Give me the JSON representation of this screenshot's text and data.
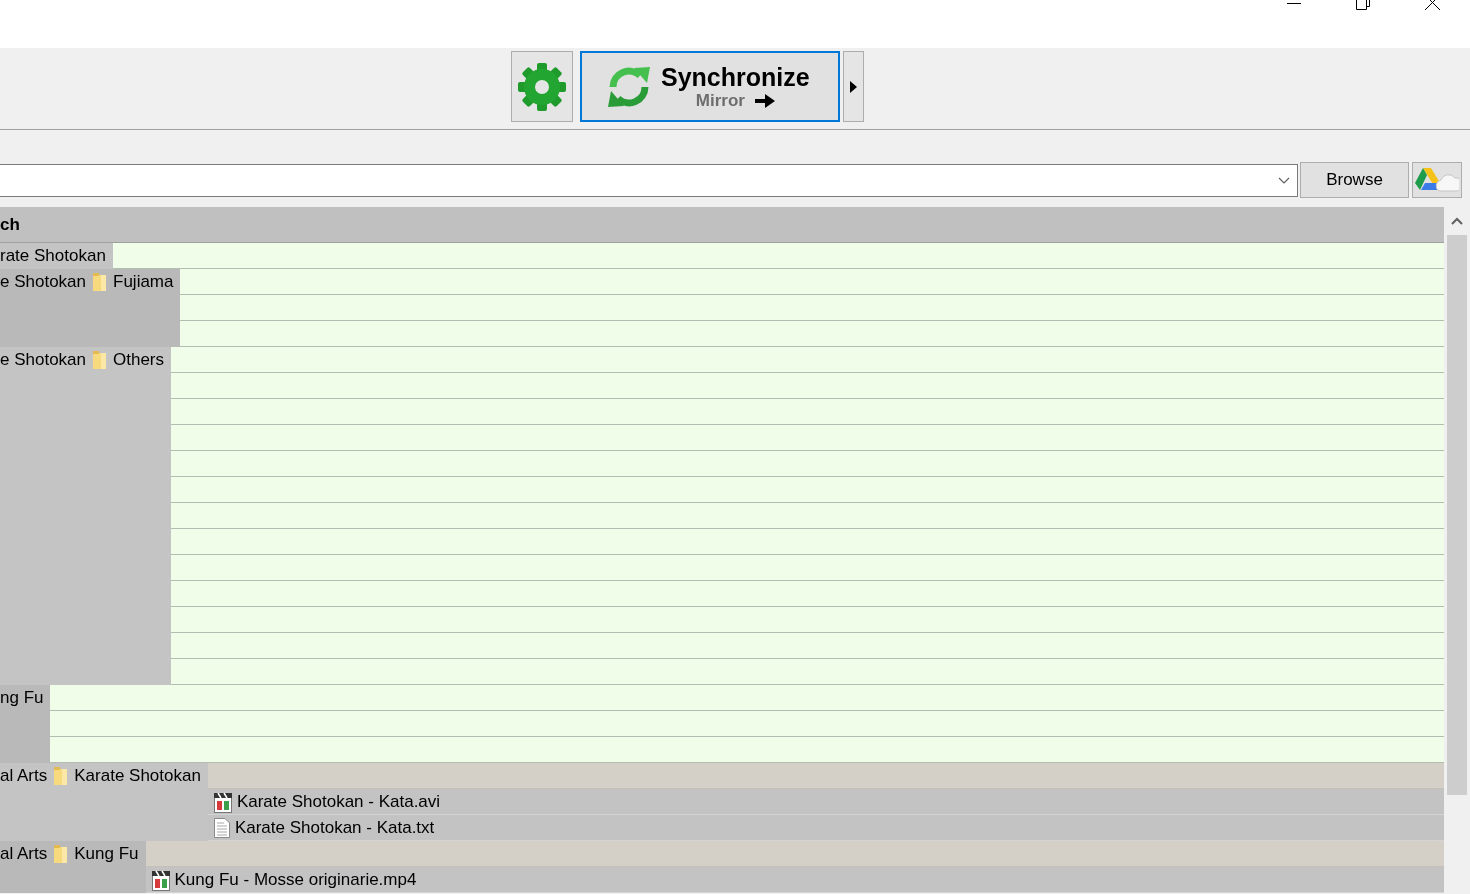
{
  "toolbar": {
    "sync_button": {
      "title": "Synchronize",
      "subtitle": "Mirror",
      "focused": true
    }
  },
  "folder_bar": {
    "browse_button": "Browse"
  },
  "grid": {
    "header": "ch",
    "groups": [
      {
        "path": [
          "rate Shotokan"
        ],
        "rows": [
          {
            "kind": "blank"
          }
        ]
      },
      {
        "path": [
          "e Shotokan",
          "Fujiama"
        ],
        "rows": [
          {
            "kind": "blank"
          },
          {
            "kind": "blank"
          },
          {
            "kind": "blank"
          }
        ]
      },
      {
        "path": [
          "e Shotokan",
          "Others"
        ],
        "rows": [
          {
            "kind": "blank"
          },
          {
            "kind": "blank"
          },
          {
            "kind": "blank"
          },
          {
            "kind": "blank"
          },
          {
            "kind": "blank"
          },
          {
            "kind": "blank"
          },
          {
            "kind": "blank"
          },
          {
            "kind": "blank"
          },
          {
            "kind": "blank"
          },
          {
            "kind": "blank"
          },
          {
            "kind": "blank"
          },
          {
            "kind": "blank"
          },
          {
            "kind": "blank"
          }
        ]
      },
      {
        "path": [
          "ng Fu"
        ],
        "rows": [
          {
            "kind": "blank"
          },
          {
            "kind": "blank"
          },
          {
            "kind": "blank"
          }
        ]
      },
      {
        "path": [
          "al Arts",
          "Karate Shotokan"
        ],
        "rows": [
          {
            "kind": "folder"
          },
          {
            "kind": "video",
            "name": "Karate Shotokan - Kata.avi"
          },
          {
            "kind": "text",
            "name": "Karate Shotokan - Kata.txt"
          }
        ]
      },
      {
        "path": [
          "al Arts",
          "Kung Fu"
        ],
        "rows": [
          {
            "kind": "folder"
          },
          {
            "kind": "video",
            "name": "Kung Fu - Mosse originarie.mp4"
          }
        ]
      }
    ]
  }
}
